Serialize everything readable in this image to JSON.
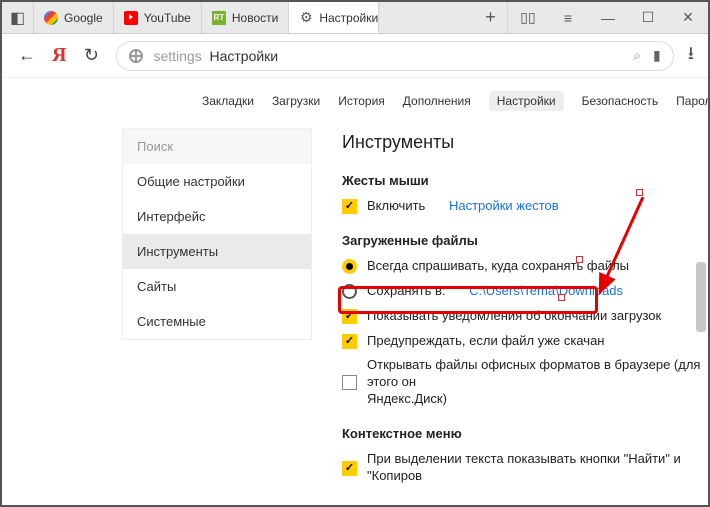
{
  "tabs": [
    {
      "label": "Google"
    },
    {
      "label": "YouTube"
    },
    {
      "label": "Новости"
    },
    {
      "label": "Настройки"
    }
  ],
  "address": {
    "prefix": "settings",
    "title": "Настройки"
  },
  "topnav": [
    "Закладки",
    "Загрузки",
    "История",
    "Дополнения",
    "Настройки",
    "Безопасность",
    "Пароли и карты"
  ],
  "topnav_active": 4,
  "sidebar": {
    "search_placeholder": "Поиск",
    "items": [
      "Общие настройки",
      "Интерфейс",
      "Инструменты",
      "Сайты",
      "Системные"
    ],
    "selected": 2
  },
  "main": {
    "title": "Инструменты",
    "mouse": {
      "heading": "Жесты мыши",
      "enable": "Включить",
      "settings_link": "Настройки жестов"
    },
    "downloads": {
      "heading": "Загруженные файлы",
      "always_ask": "Всегда спрашивать, куда сохранять файлы",
      "save_to_label": "Сохранять в:",
      "save_to_path": "C:\\Users\\Tema\\Downloads",
      "show_notify": "Показывать уведомления об окончании загрузок",
      "warn_downloaded": "Предупреждать, если файл уже скачан",
      "open_office": "Открывать файлы офисных форматов в браузере (для этого он",
      "open_office2": "Яндекс.Диск)"
    },
    "context": {
      "heading": "Контекстное меню",
      "on_select": "При выделении текста показывать кнопки \"Найти\" и \"Копиров"
    }
  }
}
